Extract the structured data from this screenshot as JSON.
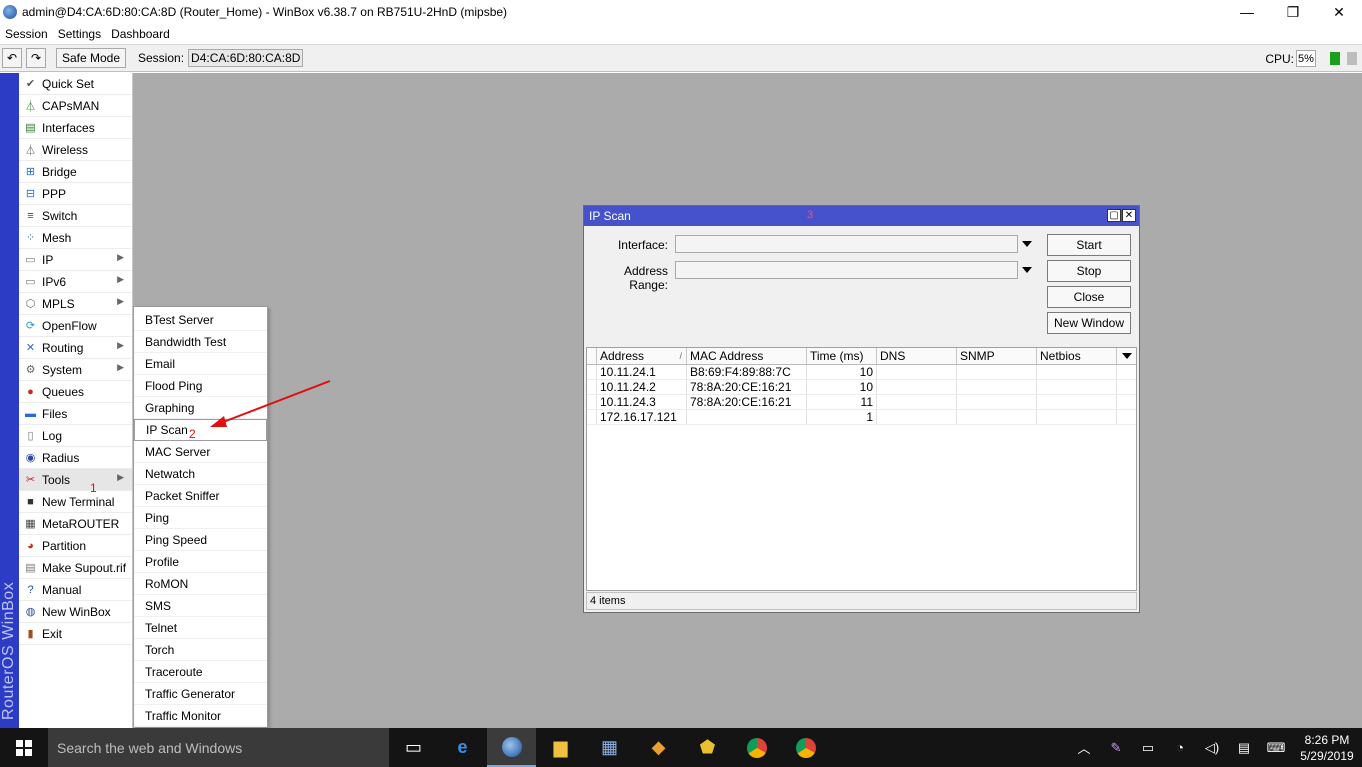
{
  "window": {
    "title": "admin@D4:CA:6D:80:CA:8D (Router_Home) - WinBox v6.38.7 on RB751U-2HnD (mipsbe)",
    "minimize": "—",
    "maximize": "❐",
    "close": "✕"
  },
  "menubar": [
    "Session",
    "Settings",
    "Dashboard"
  ],
  "toolbar": {
    "undo": "↶",
    "redo": "↷",
    "safe_mode": "Safe Mode",
    "session_label": "Session:",
    "session_value": "D4:CA:6D:80:CA:8D",
    "cpu_label": "CPU:",
    "cpu_value": "5%"
  },
  "brand": "RouterOS WinBox",
  "sidebar": {
    "items": [
      {
        "label": "Quick Set",
        "icon": "quick-set-icon",
        "glyph": "✔",
        "color": "#555",
        "arrow": false
      },
      {
        "label": "CAPsMAN",
        "icon": "capsman-icon",
        "glyph": "⏃",
        "color": "#2a7a2a",
        "arrow": false
      },
      {
        "label": "Interfaces",
        "icon": "interfaces-icon",
        "glyph": "▤",
        "color": "#2a7a2a",
        "arrow": false
      },
      {
        "label": "Wireless",
        "icon": "wireless-icon",
        "glyph": "⏃",
        "color": "#555",
        "arrow": false
      },
      {
        "label": "Bridge",
        "icon": "bridge-icon",
        "glyph": "⊞",
        "color": "#2a6ad0",
        "arrow": false
      },
      {
        "label": "PPP",
        "icon": "ppp-icon",
        "glyph": "⊟",
        "color": "#2a6ad0",
        "arrow": false
      },
      {
        "label": "Switch",
        "icon": "switch-icon",
        "glyph": "≡",
        "color": "#444",
        "arrow": false
      },
      {
        "label": "Mesh",
        "icon": "mesh-icon",
        "glyph": "⁘",
        "color": "#2a6ad0",
        "arrow": false
      },
      {
        "label": "IP",
        "icon": "ip-icon",
        "glyph": "▭",
        "color": "#777",
        "arrow": true
      },
      {
        "label": "IPv6",
        "icon": "ipv6-icon",
        "glyph": "▭",
        "color": "#777",
        "arrow": true
      },
      {
        "label": "MPLS",
        "icon": "mpls-icon",
        "glyph": "⬡",
        "color": "#666",
        "arrow": true
      },
      {
        "label": "OpenFlow",
        "icon": "openflow-icon",
        "glyph": "⟳",
        "color": "#2a9ad0",
        "arrow": false
      },
      {
        "label": "Routing",
        "icon": "routing-icon",
        "glyph": "✕",
        "color": "#2a6ad0",
        "arrow": true
      },
      {
        "label": "System",
        "icon": "system-icon",
        "glyph": "⚙",
        "color": "#666",
        "arrow": true
      },
      {
        "label": "Queues",
        "icon": "queues-icon",
        "glyph": "●",
        "color": "#c03020",
        "arrow": false
      },
      {
        "label": "Files",
        "icon": "files-icon",
        "glyph": "▬",
        "color": "#2a6ad0",
        "arrow": false
      },
      {
        "label": "Log",
        "icon": "log-icon",
        "glyph": "▯",
        "color": "#777",
        "arrow": false
      },
      {
        "label": "Radius",
        "icon": "radius-icon",
        "glyph": "◉",
        "color": "#2a4aa0",
        "arrow": false
      },
      {
        "label": "Tools",
        "icon": "tools-icon",
        "glyph": "✂",
        "color": "#c02020",
        "arrow": true
      },
      {
        "label": "New Terminal",
        "icon": "terminal-icon",
        "glyph": "■",
        "color": "#333",
        "arrow": false
      },
      {
        "label": "MetaROUTER",
        "icon": "metarouter-icon",
        "glyph": "▦",
        "color": "#444",
        "arrow": false
      },
      {
        "label": "Partition",
        "icon": "partition-icon",
        "glyph": "◕",
        "color": "#c03020",
        "arrow": false
      },
      {
        "label": "Make Supout.rif",
        "icon": "supout-icon",
        "glyph": "▤",
        "color": "#777",
        "arrow": false
      },
      {
        "label": "Manual",
        "icon": "manual-icon",
        "glyph": "?",
        "color": "#2a4aa0",
        "arrow": false
      },
      {
        "label": "New WinBox",
        "icon": "winbox-icon",
        "glyph": "◍",
        "color": "#2a4aa0",
        "arrow": false
      },
      {
        "label": "Exit",
        "icon": "exit-icon",
        "glyph": "▮",
        "color": "#a05020",
        "arrow": false
      }
    ]
  },
  "annotations": {
    "tools": "1",
    "ip_scan": "2",
    "window": "3"
  },
  "tools_submenu": [
    "BTest Server",
    "Bandwidth Test",
    "Email",
    "Flood Ping",
    "Graphing",
    "IP Scan",
    "MAC Server",
    "Netwatch",
    "Packet Sniffer",
    "Ping",
    "Ping Speed",
    "Profile",
    "RoMON",
    "SMS",
    "Telnet",
    "Torch",
    "Traceroute",
    "Traffic Generator",
    "Traffic Monitor"
  ],
  "ip_scan": {
    "title": "IP Scan",
    "interface_label": "Interface:",
    "interface_value": "",
    "range_label": "Address Range:",
    "range_value": "",
    "buttons": {
      "start": "Start",
      "stop": "Stop",
      "close": "Close",
      "new_window": "New Window"
    },
    "columns": [
      "Address",
      "MAC Address",
      "Time (ms)",
      "DNS",
      "SNMP",
      "Netbios"
    ],
    "rows": [
      {
        "address": "10.11.24.1",
        "mac": "B8:69:F4:89:88:7C",
        "time": "10",
        "dns": "",
        "snmp": "",
        "netbios": ""
      },
      {
        "address": "10.11.24.2",
        "mac": "78:8A:20:CE:16:21",
        "time": "10",
        "dns": "",
        "snmp": "",
        "netbios": ""
      },
      {
        "address": "10.11.24.3",
        "mac": "78:8A:20:CE:16:21",
        "time": "11",
        "dns": "",
        "snmp": "",
        "netbios": ""
      },
      {
        "address": "172.16.17.121",
        "mac": "",
        "time": "1",
        "dns": "",
        "snmp": "",
        "netbios": ""
      }
    ],
    "status": "4 items"
  },
  "taskbar": {
    "search_placeholder": "Search the web and Windows",
    "time": "8:26 PM",
    "date": "5/29/2019"
  }
}
